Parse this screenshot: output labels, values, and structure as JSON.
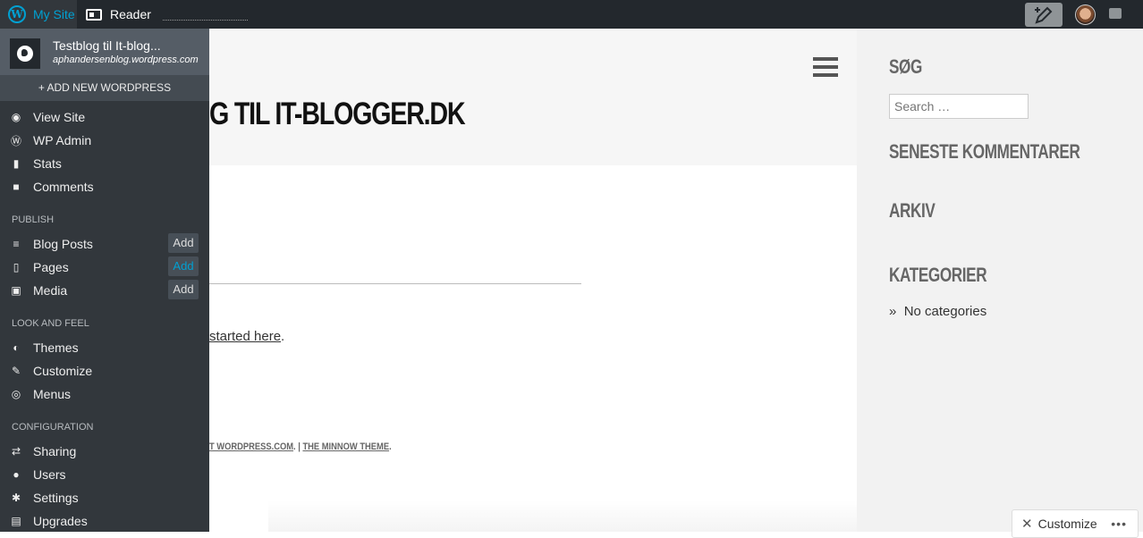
{
  "adminbar": {
    "my_site_label": "My Site",
    "reader_label": "Reader",
    "icons": [
      "wordpress-icon",
      "reader-icon",
      "write-post-icon",
      "avatar",
      "notifications-icon"
    ]
  },
  "drawer": {
    "site_name": "Testblog til It-blog...",
    "site_url": "aphandersenblog.wordpress.com",
    "add_new": "+ ADD NEW WORDPRESS",
    "items_top": [
      {
        "label": "View Site",
        "icon": "globe-icon"
      },
      {
        "label": "WP Admin",
        "icon": "wordpress-icon"
      },
      {
        "label": "Stats",
        "icon": "stats-icon"
      },
      {
        "label": "Comments",
        "icon": "comment-icon"
      }
    ],
    "section_publish": "PUBLISH",
    "items_publish": [
      {
        "label": "Blog Posts",
        "icon": "posts-icon",
        "add": "Add"
      },
      {
        "label": "Pages",
        "icon": "page-icon",
        "add": "Add"
      },
      {
        "label": "Media",
        "icon": "media-icon",
        "add": "Add"
      }
    ],
    "section_look": "LOOK AND FEEL",
    "items_look": [
      {
        "label": "Themes",
        "icon": "themes-icon"
      },
      {
        "label": "Customize",
        "icon": "customize-icon"
      },
      {
        "label": "Menus",
        "icon": "menus-icon"
      }
    ],
    "section_config": "CONFIGURATION",
    "items_config": [
      {
        "label": "Sharing",
        "icon": "sharing-icon"
      },
      {
        "label": "Users",
        "icon": "users-icon"
      },
      {
        "label": "Settings",
        "icon": "settings-icon"
      },
      {
        "label": "Upgrades",
        "icon": "upgrades-icon"
      }
    ]
  },
  "page": {
    "site_title": "G TIL IT-BLOGGER.DK",
    "content_link": "started here",
    "content_after": ".",
    "footer_prefix": "T WORDPRESS.COM",
    "footer_sep": ". | ",
    "footer_theme": "THE MINNOW THEME",
    "footer_end": "."
  },
  "sidebar": {
    "search_title": "SØG",
    "search_placeholder": "Search …",
    "recent_comments_title": "SENESTE KOMMENTARER",
    "archive_title": "ARKIV",
    "categories_title": "KATEGORIER",
    "no_categories": "No categories",
    "bullet": "»"
  },
  "customize_button": {
    "label": "Customize",
    "more": "•••"
  },
  "colors": {
    "accent": "#00a0d2",
    "adminbar": "#23282d",
    "drawer": "#32373c"
  }
}
